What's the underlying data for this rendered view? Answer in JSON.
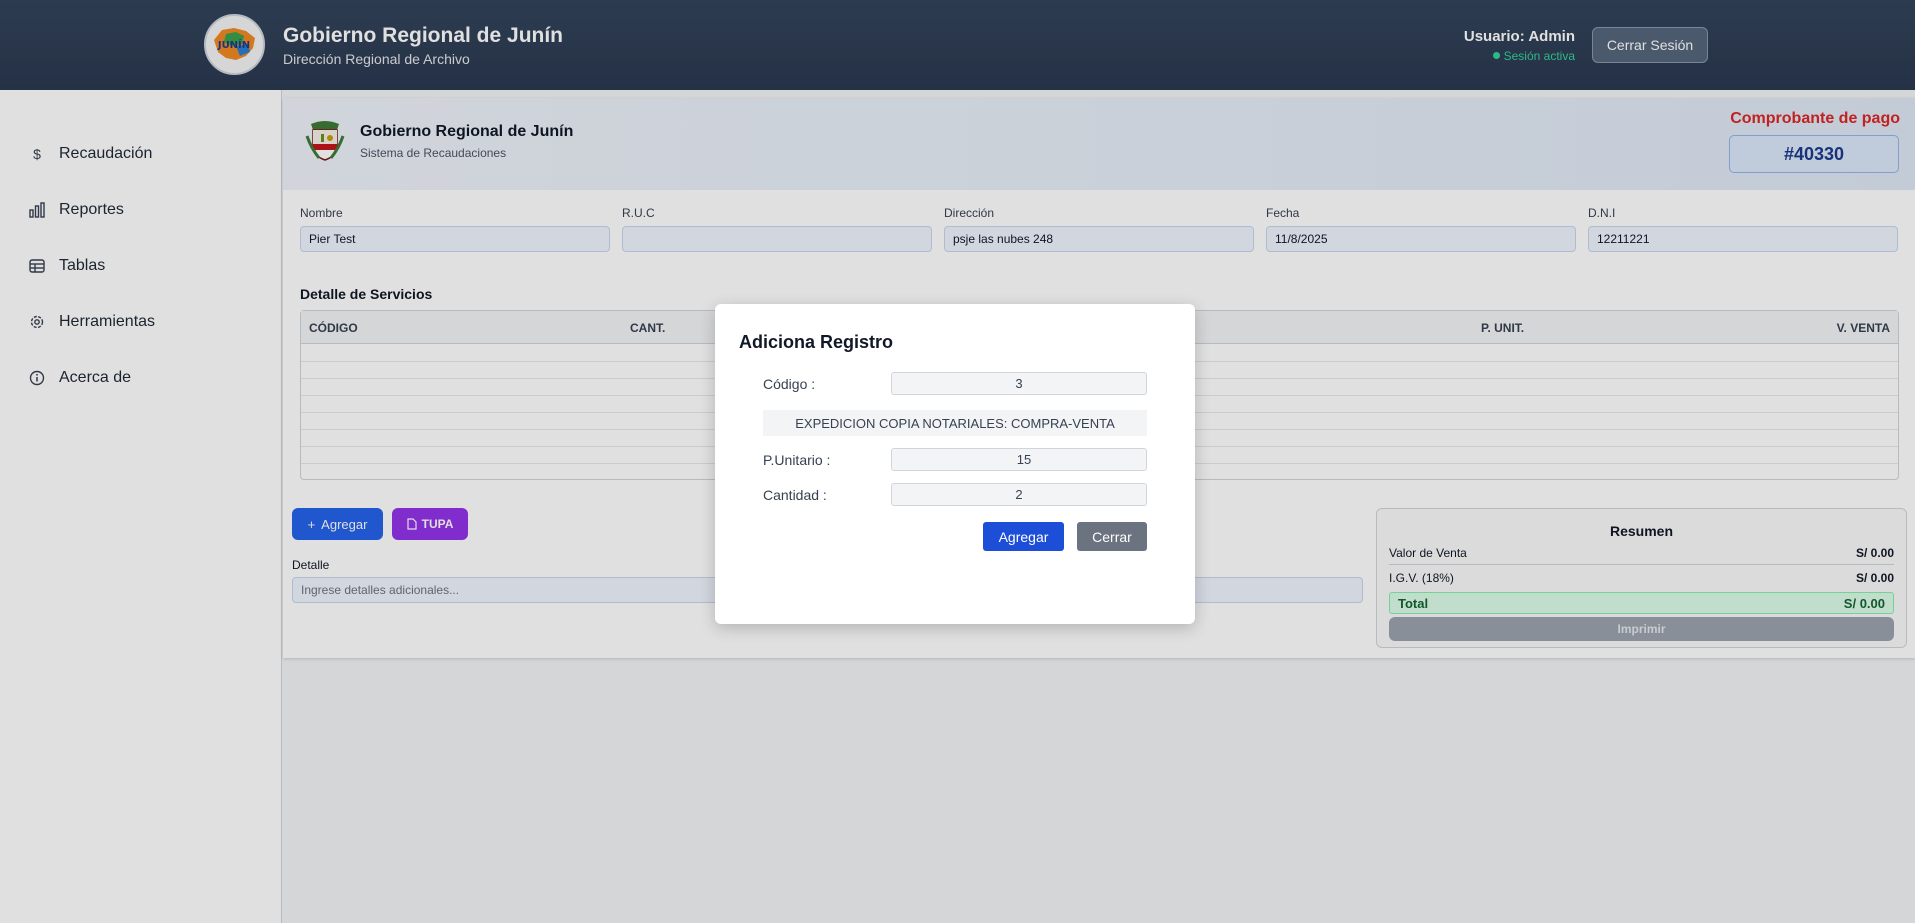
{
  "header": {
    "title": "Gobierno Regional de Junín",
    "subtitle": "Dirección Regional de Archivo",
    "logo_text": "JUNÍN",
    "user_label": "Usuario: Admin",
    "session_status": "Sesión activa",
    "logout_label": "Cerrar Sesión"
  },
  "sidebar": {
    "items": [
      {
        "label": "Recaudación",
        "icon": "dollar-icon"
      },
      {
        "label": "Reportes",
        "icon": "bar-chart-icon"
      },
      {
        "label": "Tablas",
        "icon": "table-icon"
      },
      {
        "label": "Herramientas",
        "icon": "gear-icon"
      },
      {
        "label": "Acerca de",
        "icon": "info-icon"
      }
    ]
  },
  "receipt": {
    "institution": "Gobierno Regional de Junín",
    "system": "Sistema de Recaudaciones",
    "voucher_label": "Comprobante de pago",
    "voucher_number": "#40330"
  },
  "fields": [
    {
      "label": "Nombre",
      "value": "Pier Test"
    },
    {
      "label": "R.U.C",
      "value": ""
    },
    {
      "label": "Dirección",
      "value": "psje las nubes 248"
    },
    {
      "label": "Fecha",
      "value": "11/8/2025"
    },
    {
      "label": "D.N.I",
      "value": "12211221"
    }
  ],
  "services": {
    "title": "Detalle de Servicios",
    "columns": [
      "CÓDIGO",
      "CANT.",
      "P. UNIT.",
      "V. VENTA"
    ],
    "rows": []
  },
  "actions": {
    "add_label": "Agregar",
    "tupa_label": "TUPA",
    "detail_label": "Detalle",
    "detail_placeholder": "Ingrese detalles adicionales..."
  },
  "summary": {
    "title": "Resumen",
    "sale_value_label": "Valor de Venta",
    "sale_value": "S/ 0.00",
    "igv_label": "I.G.V. (18%)",
    "igv_value": "S/ 0.00",
    "total_label": "Total",
    "total_value": "S/ 0.00",
    "print_label": "Imprimir"
  },
  "modal": {
    "title": "Adiciona Registro",
    "code_label": "Código :",
    "code_value": "3",
    "description": "EXPEDICION COPIA NOTARIALES: COMPRA-VENTA",
    "unit_price_label": "P.Unitario :",
    "unit_price_value": "15",
    "quantity_label": "Cantidad :",
    "quantity_value": "2",
    "add_label": "Agregar",
    "close_label": "Cerrar"
  },
  "colors": {
    "header_bg": "#2f3e55",
    "accent_blue": "#2563eb",
    "tupa_purple": "#9333ea",
    "voucher_red": "#dc2626",
    "session_green": "#34d399"
  }
}
